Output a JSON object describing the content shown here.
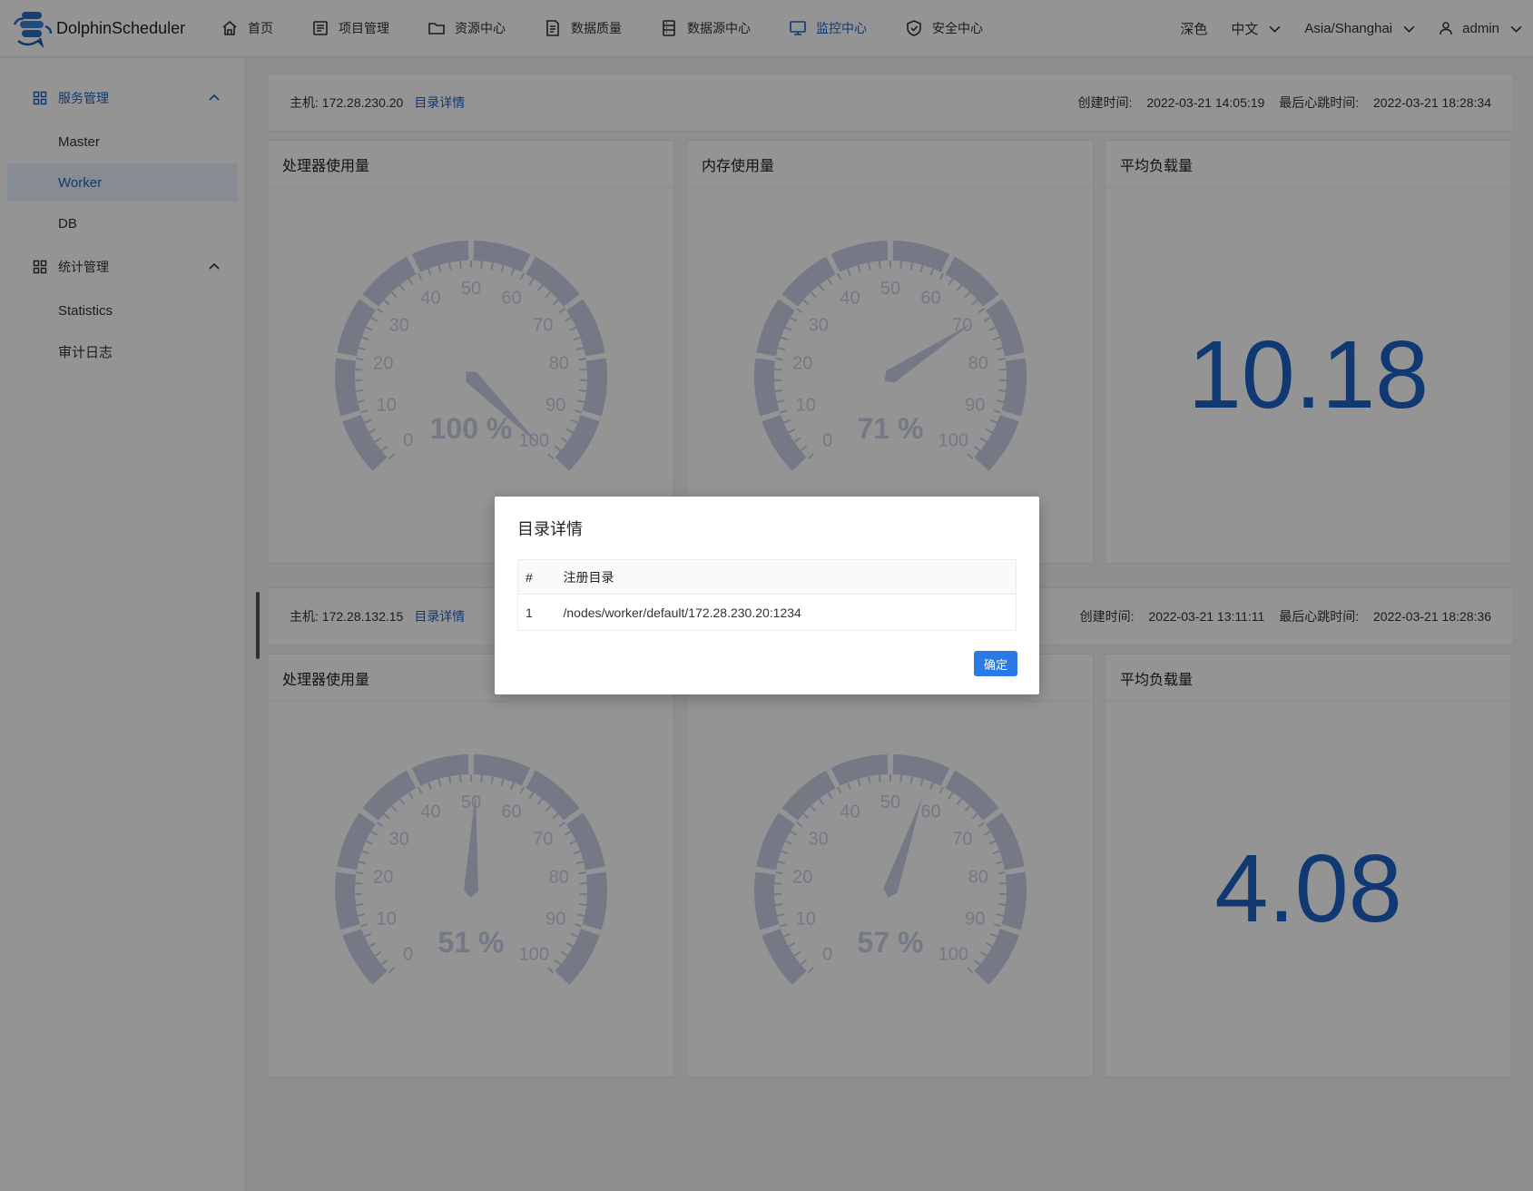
{
  "app": {
    "name": "DolphinScheduler"
  },
  "nav": [
    {
      "label": "首页",
      "icon": "home-icon"
    },
    {
      "label": "项目管理",
      "icon": "project-icon"
    },
    {
      "label": "资源中心",
      "icon": "folder-icon"
    },
    {
      "label": "数据质量",
      "icon": "document-icon"
    },
    {
      "label": "数据源中心",
      "icon": "database-icon"
    },
    {
      "label": "监控中心",
      "icon": "monitor-icon",
      "active": true
    },
    {
      "label": "安全中心",
      "icon": "shield-icon"
    }
  ],
  "header_right": {
    "theme": "深色",
    "language": "中文",
    "timezone": "Asia/Shanghai",
    "user": "admin"
  },
  "sidebar": {
    "groups": [
      {
        "label": "服务管理",
        "items": [
          "Master",
          "Worker",
          "DB"
        ]
      },
      {
        "label": "统计管理",
        "items": [
          "Statistics",
          "审计日志"
        ]
      }
    ],
    "active_item": "Worker"
  },
  "labels": {
    "host_prefix": "主机: ",
    "dir_link": "目录详情",
    "created_prefix": "创建时间: ",
    "heartbeat_prefix": "最后心跳时间: ",
    "cpu_title": "处理器使用量",
    "mem_title": "内存使用量",
    "load_title": "平均负载量"
  },
  "workers": [
    {
      "host": "172.28.230.20",
      "created": "2022-03-21 14:05:19",
      "heartbeat": "2022-03-21 18:28:34",
      "cpu": 100,
      "cpu_text": "100 %",
      "mem": 71,
      "mem_text": "71 %",
      "load": "10.18"
    },
    {
      "host": "172.28.132.15",
      "created": "2022-03-21 13:11:11",
      "heartbeat": "2022-03-21 18:28:36",
      "cpu": 51,
      "cpu_text": "51 %",
      "mem": 57,
      "mem_text": "57 %",
      "load": "4.08"
    }
  ],
  "gauge": {
    "ticks": [
      "0",
      "10",
      "20",
      "30",
      "40",
      "50",
      "60",
      "70",
      "80",
      "90",
      "100"
    ],
    "color": "#c8d0e6"
  },
  "modal": {
    "title": "目录详情",
    "columns": [
      "#",
      "注册目录"
    ],
    "rows": [
      {
        "index": "1",
        "path": "/nodes/worker/default/172.28.230.20:1234"
      }
    ],
    "confirm": "确定"
  },
  "colors": {
    "accent": "#1c63c7",
    "button": "#2a7ae6"
  }
}
